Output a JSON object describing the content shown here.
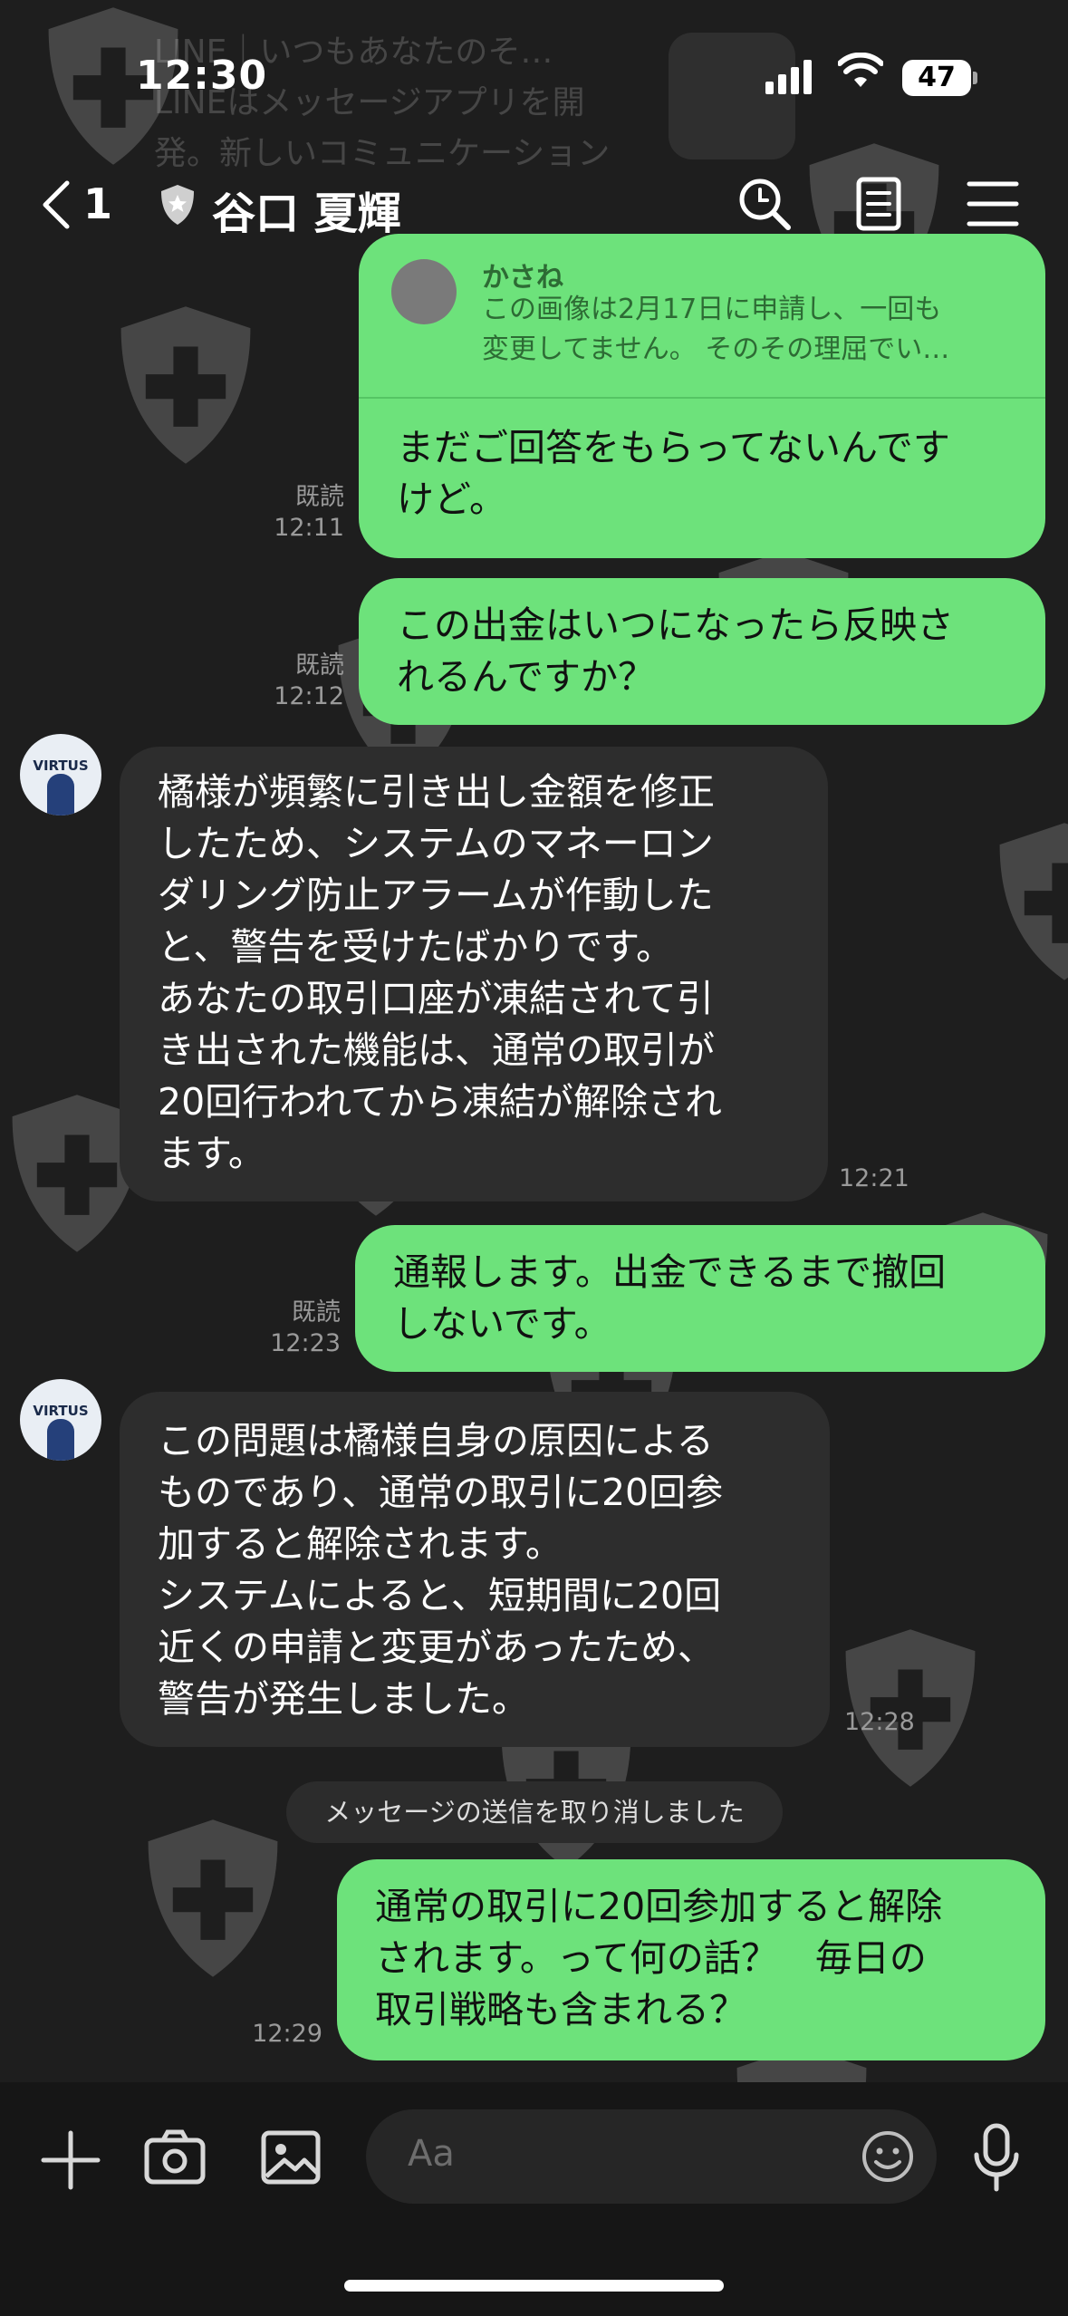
{
  "status_bar": {
    "time": "12:30",
    "battery": "47",
    "notification_ghost": [
      "LINE｜いつもあなたのそ…",
      "LINEはメッセージアプリを開",
      "発。新しいコミュニケーション"
    ]
  },
  "header": {
    "back_count": "1",
    "contact_name": "谷口 夏輝"
  },
  "messages": {
    "reply_quote": {
      "author": "かさね",
      "text_line1": "この画像は2月17日に申請し、一回も",
      "text_line2": "変更してません。 そのその理屈でい…"
    },
    "m1": {
      "line1": "まだご回答をもらってないんです",
      "line2": "けど。",
      "read": "既読",
      "time": "12:11"
    },
    "m2": {
      "line1": "この出金はいつになったら反映さ",
      "line2": "れるんですか？",
      "read": "既読",
      "time": "12:12"
    },
    "m3": {
      "lines": [
        "橘様が頻繁に引き出し金額を修正",
        "したため、システムのマネーロン",
        "ダリング防止アラームが作動した",
        "と、警告を受けたばかりです。",
        "あなたの取引口座が凍結されて引",
        "き出された機能は、通常の取引が",
        "20回行われてから凍結が解除され",
        "ます。"
      ],
      "time": "12:21"
    },
    "m4": {
      "line1": "通報します。出金できるまで撤回",
      "line2": "しないです。",
      "read": "既読",
      "time": "12:23"
    },
    "m5": {
      "lines": [
        "この問題は橘様自身の原因による",
        "ものであり、通常の取引に20回参",
        "加すると解除されます。",
        "システムによると、短期間に20回",
        "近くの申請と変更があったため、",
        "警告が発生しました。"
      ],
      "time": "12:28"
    },
    "system_notice": "メッセージの送信を取り消しました",
    "m6": {
      "lines": [
        "通常の取引に20回参加すると解除",
        "されます。って何の話？　毎日の",
        "取引戦略も含まれる？"
      ],
      "time": "12:29"
    }
  },
  "avatar_text": "VIRTUS",
  "input": {
    "placeholder": "Aa"
  },
  "colors": {
    "background": "#1e1e1e",
    "sent_bubble": "#6de27b",
    "received_bubble": "#2d2d2d"
  }
}
